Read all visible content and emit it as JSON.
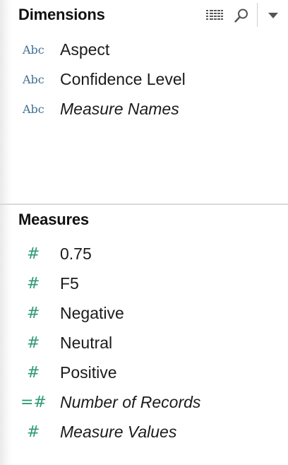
{
  "dimensions": {
    "title": "Dimensions",
    "fields": [
      {
        "type_label": "Abc",
        "name": "Aspect",
        "italic": false
      },
      {
        "type_label": "Abc",
        "name": "Confidence Level",
        "italic": false
      },
      {
        "type_label": "Abc",
        "name": "Measure Names",
        "italic": true
      }
    ]
  },
  "toolbar": {
    "icons": [
      "list-view-icon",
      "search-icon",
      "dropdown-arrow-icon"
    ]
  },
  "measures": {
    "title": "Measures",
    "fields": [
      {
        "type_label": "#",
        "name": "0.75",
        "italic": false
      },
      {
        "type_label": "#",
        "name": "F5",
        "italic": false
      },
      {
        "type_label": "#",
        "name": "Negative",
        "italic": false
      },
      {
        "type_label": "#",
        "name": "Neutral",
        "italic": false
      },
      {
        "type_label": "#",
        "name": "Positive",
        "italic": false
      },
      {
        "type_label": "=#",
        "name": "Number of Records",
        "italic": true
      },
      {
        "type_label": "#",
        "name": "Measure Values",
        "italic": true
      }
    ]
  },
  "colors": {
    "dimension_icon": "#3f6f8f",
    "measure_icon": "#2e9a72",
    "text": "#1b1b1b",
    "divider": "#d9d9d9"
  }
}
